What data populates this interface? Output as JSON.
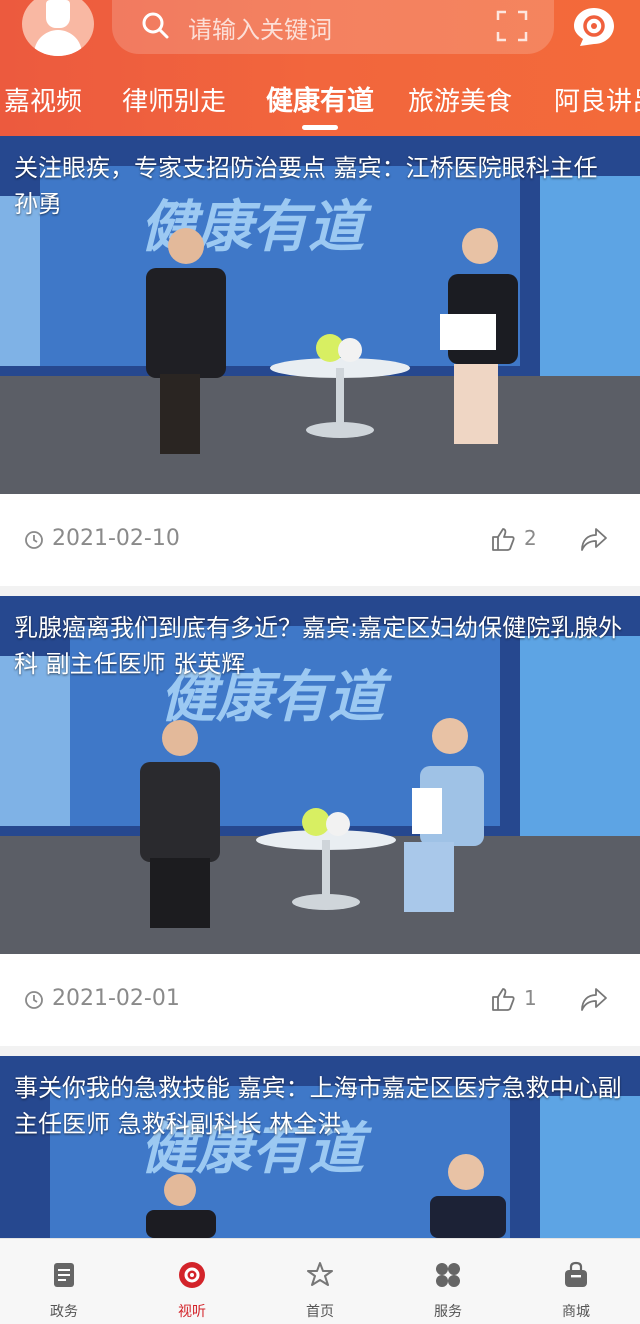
{
  "header": {
    "search_placeholder": "请输入关键词",
    "tabs": [
      {
        "label": "嘉视频"
      },
      {
        "label": "律师别走"
      },
      {
        "label": "健康有道",
        "active": true
      },
      {
        "label": "旅游美食"
      },
      {
        "label": "阿良讲吕"
      }
    ]
  },
  "feed": {
    "items": [
      {
        "title": "关注眼疾，专家支招防治要点 嘉宾：江桥医院眼科主任 孙勇",
        "overlay": "健康有道",
        "date": "2021-02-10",
        "likes": "2"
      },
      {
        "title": "乳腺癌离我们到底有多近？嘉宾:嘉定区妇幼保健院乳腺外科 副主任医师 张英辉",
        "overlay": "健康有道",
        "date": "2021-02-01",
        "likes": "1"
      },
      {
        "title": "事关你我的急救技能 嘉宾：上海市嘉定区医疗急救中心副主任医师 急救科副科长 林全洪",
        "overlay": "健康有道"
      }
    ]
  },
  "bottom_nav": {
    "items": [
      {
        "label": "政务",
        "icon": "document-icon"
      },
      {
        "label": "视听",
        "icon": "play-circle-icon",
        "active": true
      },
      {
        "label": "首页",
        "icon": "home-star-icon"
      },
      {
        "label": "服务",
        "icon": "grid-icon"
      },
      {
        "label": "商城",
        "icon": "bag-icon"
      }
    ]
  },
  "colors": {
    "header": "#f0603d",
    "accent": "#d3242a",
    "meta_text": "#8a8a8a"
  }
}
